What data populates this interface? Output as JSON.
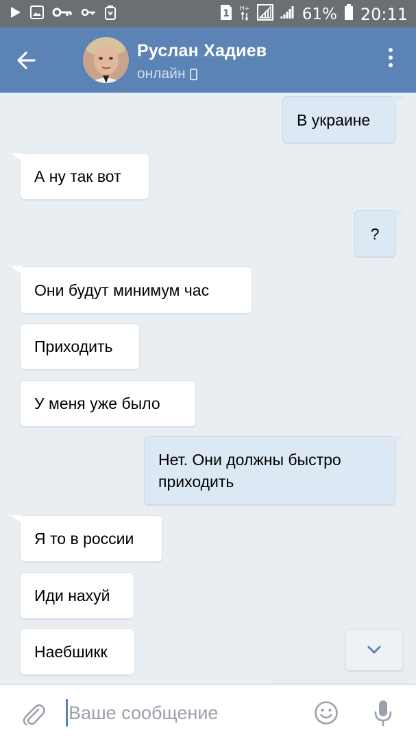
{
  "status_bar": {
    "battery_percent": "61%",
    "time": "20:11",
    "sim_slot": "1",
    "network_type": "H+",
    "icons": [
      "play-icon",
      "image-icon",
      "key-icon",
      "key-small-icon",
      "recycle-icon",
      "sim-icon",
      "signal-icon",
      "signal-icon",
      "battery-icon"
    ]
  },
  "header": {
    "contact_name": "Руслан Хадиев",
    "status": "онлайн",
    "colors": {
      "header_bg": "#5b83b5",
      "status_text": "#d2def0"
    }
  },
  "messages": [
    {
      "direction": "out",
      "text": "В украине"
    },
    {
      "direction": "in",
      "text": "А ну так вот"
    },
    {
      "direction": "out",
      "text": "?"
    },
    {
      "direction": "in",
      "text": "Они будут минимум час"
    },
    {
      "direction": "in",
      "text": "Приходить"
    },
    {
      "direction": "in",
      "text": "У меня уже было"
    },
    {
      "direction": "out",
      "text": "Нет. Они должны быстро приходить"
    },
    {
      "direction": "in",
      "text": "Я то в россии"
    },
    {
      "direction": "in",
      "text": "Иди нахуй"
    },
    {
      "direction": "in",
      "text": "Наебшикк"
    }
  ],
  "input": {
    "placeholder": "Ваше сообщение",
    "value": ""
  },
  "colors": {
    "chat_bg": "#e9eef3",
    "incoming_bubble": "#ffffff",
    "outgoing_bubble": "#dde8f5",
    "accent": "#5b83b5"
  }
}
